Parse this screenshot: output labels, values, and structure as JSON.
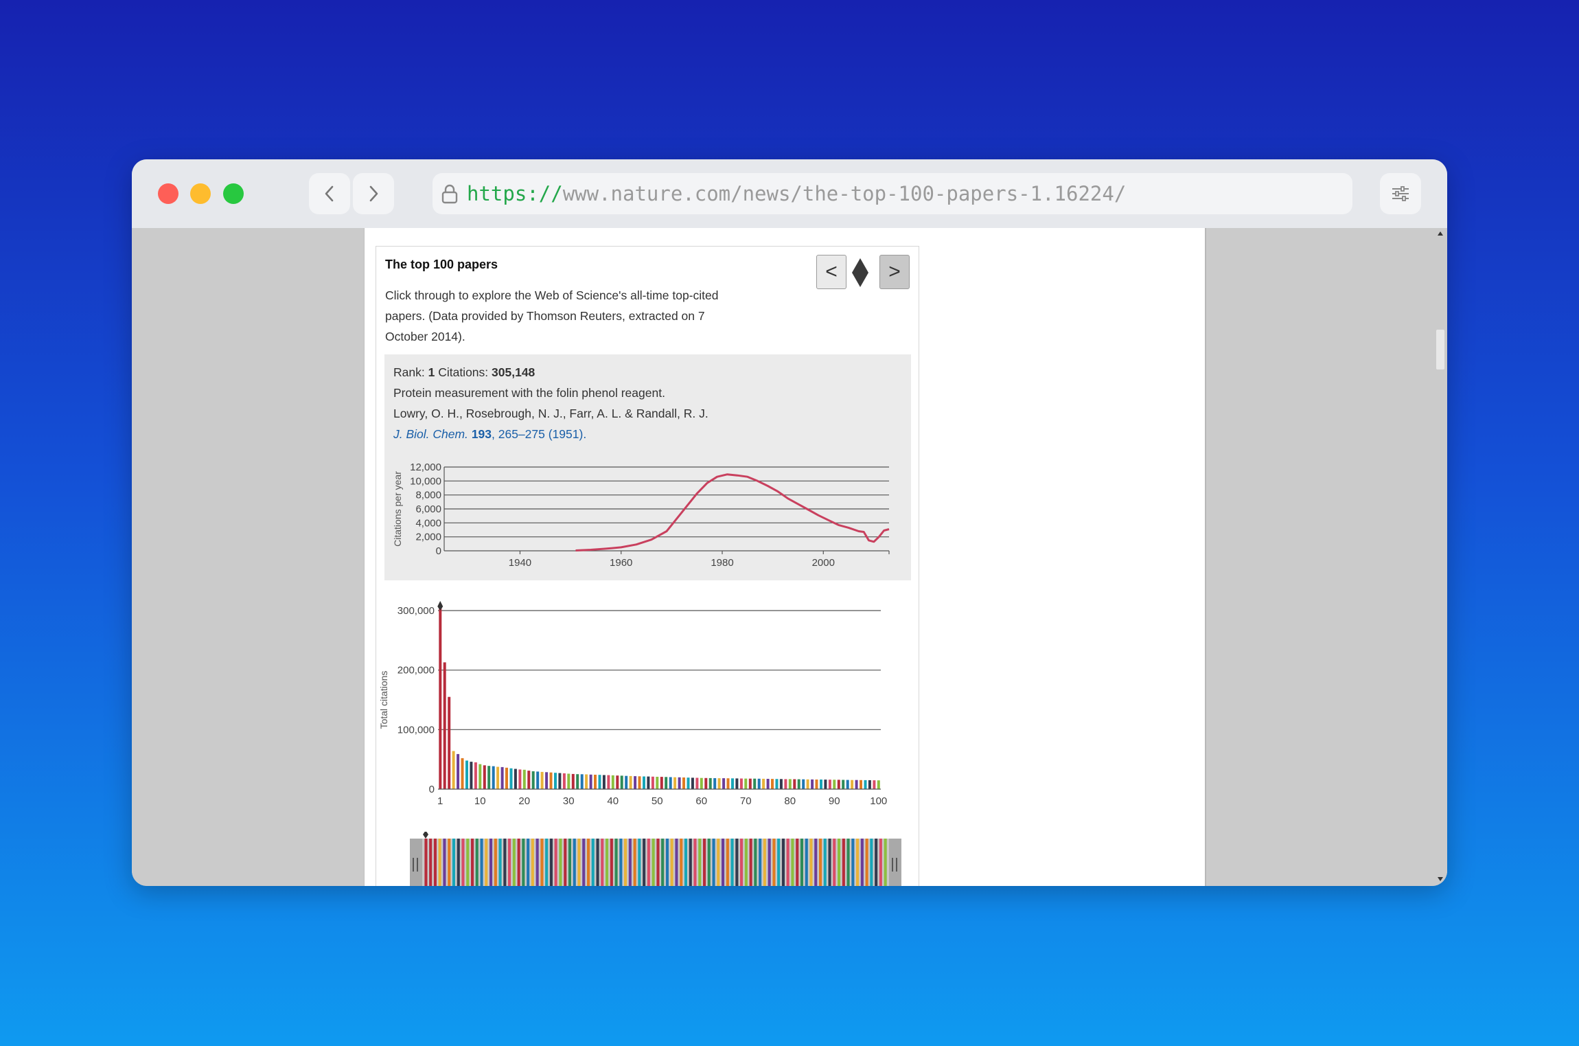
{
  "browser": {
    "url_scheme": "https://",
    "url_rest": "www.nature.com/news/the-top-100-papers-1.16224/",
    "traffic_colors": [
      "#fe5f57",
      "#febc2e",
      "#28c840"
    ]
  },
  "widget": {
    "title": "The top 100 papers",
    "description": "Click through to explore the Web of Science's all-time top-cited papers. (Data provided by Thomson Reuters, extracted on 7 October 2014).",
    "prev_label": "<",
    "next_label": ">",
    "rank_label": "Rank:",
    "rank": "1",
    "citations_label": "Citations:",
    "citations": "305,148",
    "paper_title": "Protein measurement with the folin phenol reagent.",
    "authors": "Lowry, O. H., Rosebrough, N. J., Farr, A. L. & Randall, R. J.",
    "journal": "J. Biol. Chem.",
    "volume": "193",
    "pages_year": ", 265–275 (1951)."
  },
  "chart_data": [
    {
      "type": "line",
      "ylabel": "Citations per year",
      "xlabel": "",
      "title": "",
      "ylim": [
        0,
        12000
      ],
      "xlim": [
        1925,
        2013
      ],
      "yticks": [
        "0",
        "2,000",
        "4,000",
        "6,000",
        "8,000",
        "10,000",
        "12,000"
      ],
      "xticks": [
        "1940",
        "1960",
        "1980",
        "2000"
      ],
      "grid": true,
      "color": "#c9405e",
      "x": [
        1951,
        1954,
        1957,
        1960,
        1963,
        1966,
        1969,
        1972,
        1975,
        1977,
        1979,
        1981,
        1983,
        1985,
        1987,
        1989,
        1991,
        1993,
        1995,
        1997,
        1999,
        2001,
        2003,
        2005,
        2007,
        2008,
        2009,
        2010,
        2011,
        2012,
        2013
      ],
      "y": [
        50,
        150,
        300,
        500,
        900,
        1600,
        2800,
        5500,
        8200,
        9700,
        10600,
        10950,
        10800,
        10600,
        10000,
        9300,
        8500,
        7500,
        6700,
        5900,
        5100,
        4400,
        3700,
        3300,
        2800,
        2700,
        1500,
        1300,
        2000,
        2900,
        3100
      ]
    },
    {
      "type": "bar",
      "ylabel": "Total citations",
      "xlabel": "",
      "title": "",
      "ylim": [
        0,
        300000
      ],
      "yticks": [
        "0",
        "100,000",
        "200,000",
        "300,000"
      ],
      "xticks": [
        "1",
        "10",
        "20",
        "30",
        "40",
        "50",
        "60",
        "70",
        "80",
        "90",
        "100"
      ],
      "grid": true,
      "selected_rank": 1,
      "palette": [
        "#b72c3b",
        "#2e8b57",
        "#1f77b4",
        "#e8b33a",
        "#6a3d9a",
        "#e07b22",
        "#17a6b8",
        "#333a4e",
        "#d94c68",
        "#8cbf3f"
      ],
      "values": [
        305148,
        213000,
        155000,
        64000,
        59000,
        52000,
        48000,
        46000,
        45000,
        42000,
        40000,
        39000,
        38500,
        37500,
        37000,
        36000,
        35000,
        34000,
        33000,
        32500,
        31000,
        30000,
        29500,
        29000,
        28500,
        28000,
        27500,
        27000,
        26500,
        26000,
        25500,
        25200,
        25000,
        24800,
        24500,
        24200,
        24000,
        23700,
        23500,
        23200,
        22900,
        22600,
        22300,
        22000,
        21800,
        21600,
        21400,
        21200,
        21000,
        20800,
        20600,
        20400,
        20200,
        20000,
        19800,
        19600,
        19400,
        19200,
        19000,
        18800,
        18700,
        18600,
        18500,
        18400,
        18300,
        18200,
        18100,
        18000,
        17900,
        17800,
        17700,
        17600,
        17500,
        17400,
        17300,
        17200,
        17100,
        17000,
        16900,
        16800,
        16700,
        16600,
        16500,
        16400,
        16300,
        16200,
        16100,
        16000,
        15900,
        15800,
        15700,
        15600,
        15500,
        15400,
        15300,
        15200,
        15100,
        15000,
        14900,
        14800
      ]
    }
  ]
}
